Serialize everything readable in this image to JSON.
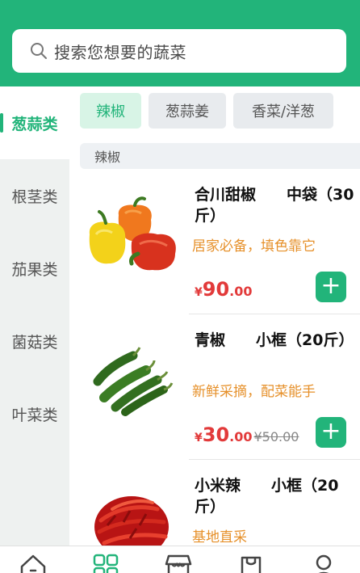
{
  "search": {
    "placeholder": "搜索您想要的蔬菜"
  },
  "sidebar": {
    "items": [
      {
        "label": "葱蒜类",
        "active": true
      },
      {
        "label": "根茎类",
        "active": false
      },
      {
        "label": "茄果类",
        "active": false
      },
      {
        "label": "菌菇类",
        "active": false
      },
      {
        "label": "叶菜类",
        "active": false
      }
    ]
  },
  "tabs": [
    {
      "label": "辣椒",
      "active": true
    },
    {
      "label": "葱蒜姜",
      "active": false
    },
    {
      "label": "香菜/洋葱",
      "active": false
    }
  ],
  "section": {
    "title": "辣椒"
  },
  "products": [
    {
      "name": "合川甜椒　　中袋（30斤）",
      "desc": "居家必备，填色靠它",
      "currency": "¥",
      "price_int": "90",
      "price_dec": ".00",
      "old_price": ""
    },
    {
      "name": "青椒　　小框（20斤）",
      "desc": "新鲜采摘，配菜能手",
      "currency": "¥",
      "price_int": "30",
      "price_dec": ".00",
      "old_price": "¥50.00"
    },
    {
      "name": "小米辣　　小框（20斤）",
      "desc": "基地直采",
      "currency": "¥",
      "price_int": "",
      "price_dec": "",
      "old_price": ""
    }
  ],
  "add_button": {
    "symbol": "+"
  },
  "tabbar": {
    "icons": [
      "home-icon",
      "category-icon",
      "store-icon",
      "cart-icon",
      "user-icon"
    ],
    "active_index": 1
  },
  "colors": {
    "brand": "#22b47a",
    "price": "#e23a3a",
    "desc": "#e6902a"
  }
}
